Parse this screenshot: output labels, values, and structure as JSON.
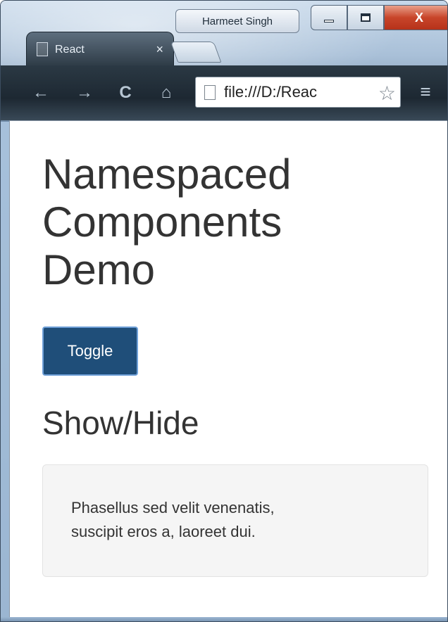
{
  "window": {
    "profile_name": "Harmeet Singh",
    "controls": {
      "minimize": "minimize",
      "maximize": "maximize",
      "close": "X"
    }
  },
  "tab": {
    "title": "React",
    "close_glyph": "×"
  },
  "toolbar": {
    "back_glyph": "←",
    "forward_glyph": "→",
    "reload_glyph": "C",
    "home_glyph": "⌂",
    "url": "file:///D:/Reac",
    "star_glyph": "☆",
    "menu_glyph": "≡"
  },
  "page": {
    "title_line1": "Namespaced",
    "title_line2": "Components",
    "title_line3": "Demo",
    "toggle_label": "Toggle",
    "section_title": "Show/Hide",
    "well_line1": "Phasellus sed velit venenatis,",
    "well_line2": "suscipit eros a, laoreet dui."
  },
  "icons": {
    "tab_page": "page-icon",
    "back": "back-arrow-icon",
    "forward": "forward-arrow-icon",
    "reload": "reload-icon",
    "home": "home-icon",
    "bookmark": "star-icon",
    "menu": "hamburger-menu-icon"
  },
  "colors": {
    "button_bg": "#1f4e79",
    "button_border": "#6fa0d8",
    "text": "#333333",
    "well_bg": "#f5f5f5"
  }
}
